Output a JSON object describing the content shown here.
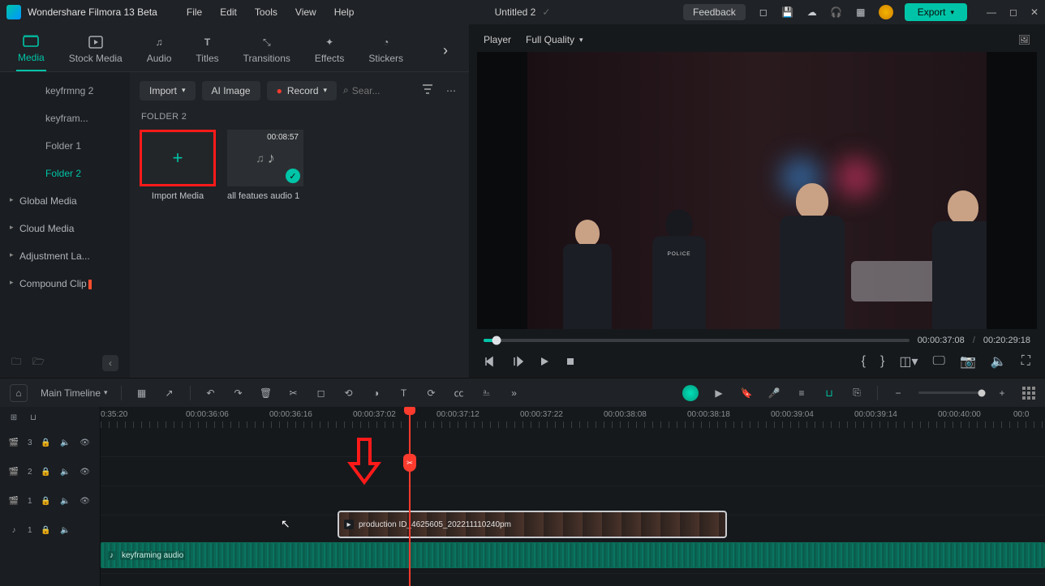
{
  "titlebar": {
    "app_name": "Wondershare Filmora 13 Beta",
    "menu": [
      "File",
      "Edit",
      "Tools",
      "View",
      "Help"
    ],
    "doc_title": "Untitled 2",
    "feedback": "Feedback",
    "export": "Export"
  },
  "tabs": [
    {
      "label": "Media",
      "active": true
    },
    {
      "label": "Stock Media",
      "active": false
    },
    {
      "label": "Audio",
      "active": false
    },
    {
      "label": "Titles",
      "active": false
    },
    {
      "label": "Transitions",
      "active": false
    },
    {
      "label": "Effects",
      "active": false
    },
    {
      "label": "Stickers",
      "active": false
    }
  ],
  "sidebar": {
    "subs": [
      "keyfrmng 2",
      "keyfram...",
      "Folder 1",
      "Folder 2"
    ],
    "active_sub": "Folder 2",
    "groups": [
      "Global Media",
      "Cloud Media",
      "Adjustment La...",
      "Compound Clip"
    ]
  },
  "media": {
    "import_btn": "Import",
    "ai_image": "AI Image",
    "record": "Record",
    "search_placeholder": "Sear...",
    "folder_label": "FOLDER 2",
    "import_tile": "Import Media",
    "clip": {
      "duration": "00:08:57",
      "name": "all featues audio 1"
    }
  },
  "player": {
    "label": "Player",
    "quality": "Full Quality",
    "current_tc": "00:00:37:08",
    "total_tc": "00:20:29:18"
  },
  "timeline": {
    "name": "Main Timeline",
    "ruler": [
      "0:35:20",
      "00:00:36:06",
      "00:00:36:16",
      "00:00:37:02",
      "00:00:37:12",
      "00:00:37:22",
      "00:00:38:08",
      "00:00:38:18",
      "00:00:39:04",
      "00:00:39:14",
      "00:00:40:00",
      "00:0"
    ],
    "video_clip": "production ID_4625605_202211110240pm",
    "audio_clip": "keyframing audio",
    "track_labels": [
      "3",
      "2",
      "1",
      "1"
    ]
  }
}
